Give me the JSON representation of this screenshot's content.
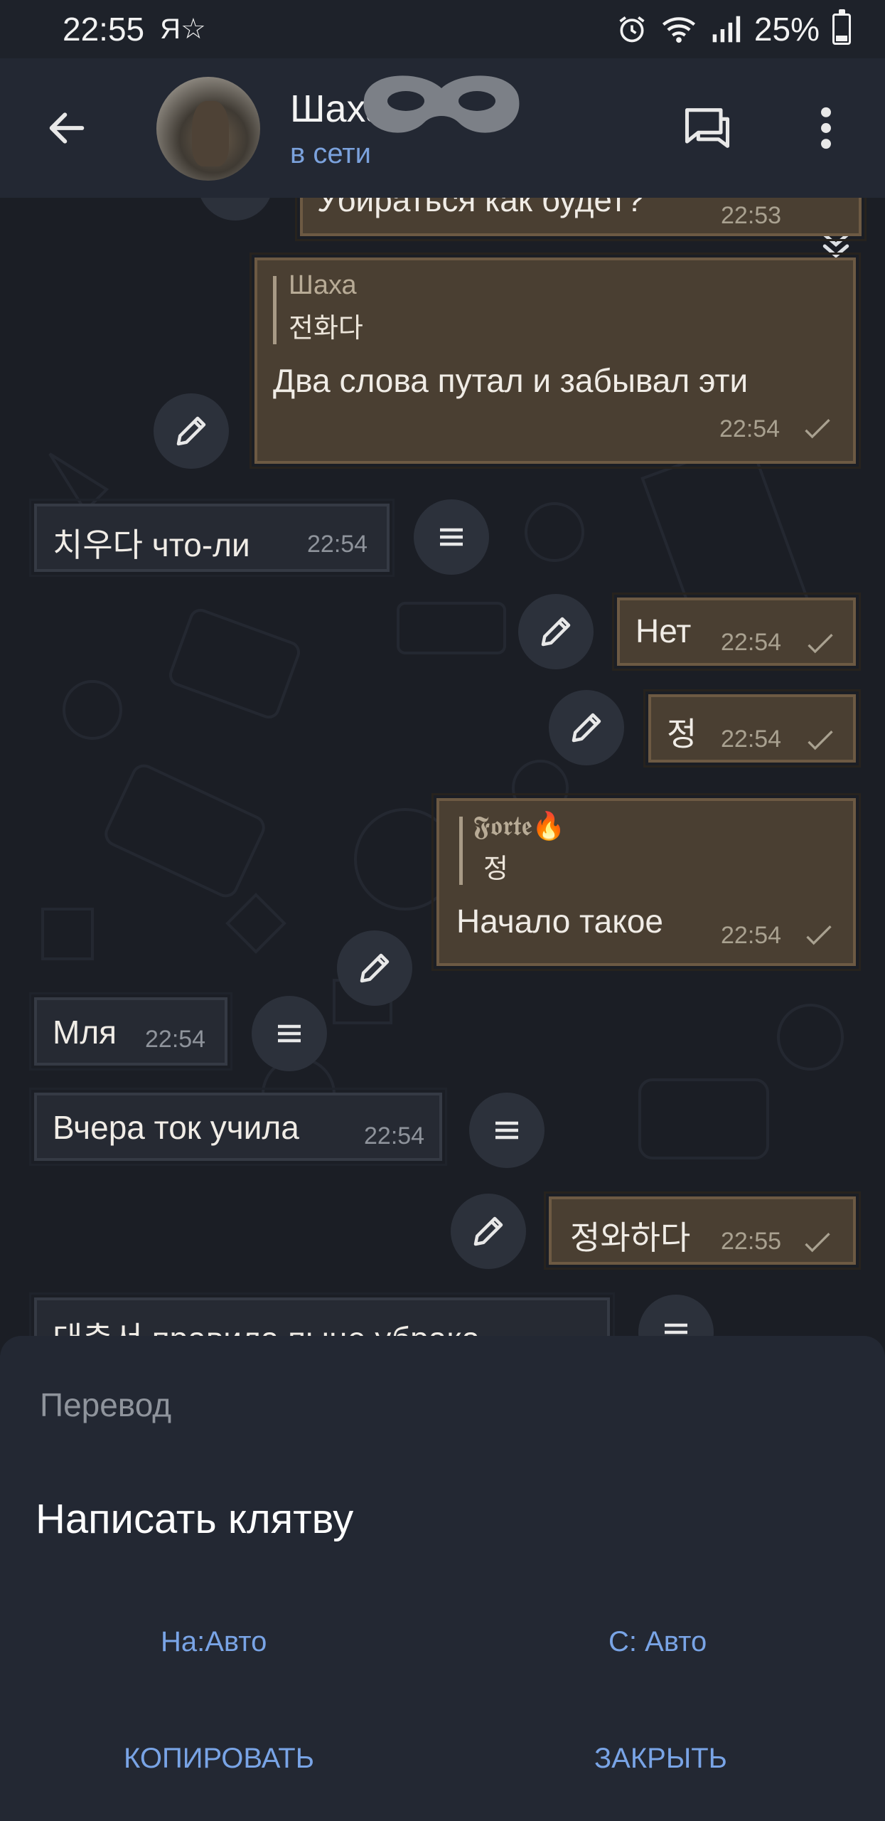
{
  "status_bar": {
    "time": "22:55",
    "carrier_glyph": "Я☆",
    "battery": "25%",
    "battery_level": 0.25
  },
  "header": {
    "contact_name": "Шаха",
    "contact_status": "в сети"
  },
  "messages": [
    {
      "dir": "out",
      "text": "Убираться как будет?",
      "time": "22:53"
    },
    {
      "dir": "out",
      "quote_name": "Шаха",
      "quote_text": "전화다",
      "text": "Два слова путал и забывал эти",
      "time": "22:54"
    },
    {
      "dir": "in",
      "text": "치우다 что-ли",
      "time": "22:54"
    },
    {
      "dir": "out",
      "text": "Нет",
      "time": "22:54"
    },
    {
      "dir": "out",
      "text": "정",
      "time": "22:54"
    },
    {
      "dir": "out",
      "quote_name": "𝕱𝖔𝖗𝖙𝖊🔥",
      "quote_text": "정",
      "text": "Начало такое",
      "time": "22:54"
    },
    {
      "dir": "in",
      "text": "Мля",
      "time": "22:54"
    },
    {
      "dir": "in",
      "text": "Вчера ток учила",
      "time": "22:54"
    },
    {
      "dir": "out",
      "text": "정와하다",
      "time": "22:55"
    },
    {
      "dir": "in",
      "text": "대충서 правила пыце убрака",
      "time": ""
    }
  ],
  "translate_sheet": {
    "title": "Перевод",
    "text": "Написать клятву",
    "to_lang": "На:Авто",
    "from_lang": "С: Авто",
    "copy_label": "КОПИРОВАТЬ",
    "close_label": "ЗАКРЫТЬ"
  },
  "icons": {
    "back": "arrow-left-icon",
    "chat": "chat-bubble-icon",
    "more": "more-vert-icon",
    "edit": "pencil-icon",
    "menu": "menu-lines-icon",
    "scroll": "double-chevron-down-icon"
  },
  "colors": {
    "background": "#1b1e25",
    "header": "#232833",
    "outgoing_bubble": "#4a3f32",
    "incoming_bubble": "#262a33",
    "accent": "#79a4e6"
  }
}
